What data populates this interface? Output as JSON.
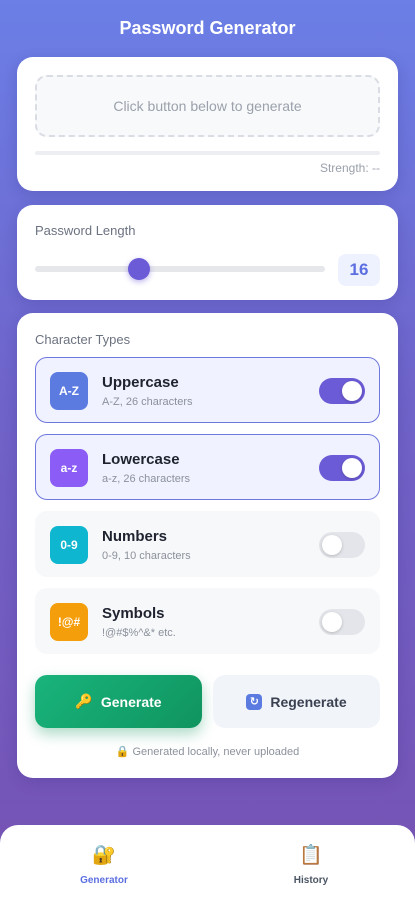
{
  "app": {
    "title": "Password Generator"
  },
  "output": {
    "placeholder": "Click button below to generate",
    "strength_text": "Strength: --"
  },
  "length": {
    "label": "Password Length",
    "value": "16",
    "min": 4,
    "max": 64,
    "current": 16
  },
  "types": {
    "label": "Character Types",
    "items": [
      {
        "icon": "A-Z",
        "name": "Uppercase",
        "desc": "A-Z, 26 characters",
        "enabled": true,
        "color": "#5b7be0"
      },
      {
        "icon": "a-z",
        "name": "Lowercase",
        "desc": "a-z, 26 characters",
        "enabled": true,
        "color": "#8b5cf6"
      },
      {
        "icon": "0-9",
        "name": "Numbers",
        "desc": "0-9, 10 characters",
        "enabled": false,
        "color": "#0fb6d0"
      },
      {
        "icon": "!@#",
        "name": "Symbols",
        "desc": "!@#$%^&* etc.",
        "enabled": false,
        "color": "#f59e0b"
      }
    ]
  },
  "actions": {
    "generate_icon": "🔑",
    "generate_label": "Generate",
    "regenerate_icon": "↻",
    "regenerate_label": "Regenerate"
  },
  "note": "🔒 Generated locally, never uploaded",
  "nav": {
    "items": [
      {
        "icon": "🔐",
        "label": "Generator",
        "active": true
      },
      {
        "icon": "📋",
        "label": "History",
        "active": false
      }
    ]
  },
  "colors": {
    "accent": "#6b5bd6",
    "generate": "#10945f",
    "value": "#5b6fe0"
  }
}
